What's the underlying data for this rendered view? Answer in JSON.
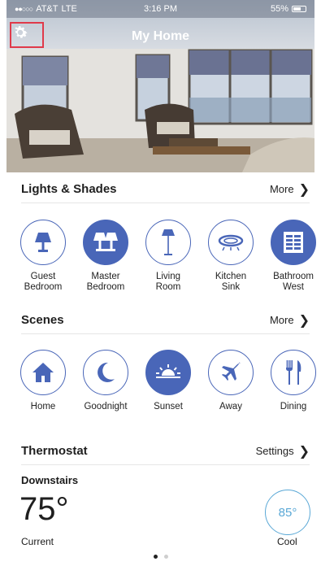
{
  "status_bar": {
    "carrier": "AT&T",
    "network": "LTE",
    "time": "3:16 PM",
    "battery": "55%"
  },
  "header": {
    "title": "My Home",
    "settings_icon": "gear-icon"
  },
  "lights": {
    "title": "Lights & Shades",
    "more_label": "More",
    "items": [
      {
        "label": "Guest\nBedroom",
        "icon": "table-lamp-icon",
        "active": false
      },
      {
        "label": "Master\nBedroom",
        "icon": "double-lamp-icon",
        "active": true
      },
      {
        "label": "Living\nRoom",
        "icon": "floor-lamp-icon",
        "active": false
      },
      {
        "label": "Kitchen\nSink",
        "icon": "ceiling-light-icon",
        "active": false
      },
      {
        "label": "Bathroom\nWest",
        "icon": "window-shade-icon",
        "active": true
      }
    ]
  },
  "scenes": {
    "title": "Scenes",
    "more_label": "More",
    "items": [
      {
        "label": "Home",
        "icon": "house-icon",
        "active": false
      },
      {
        "label": "Goodnight",
        "icon": "moon-icon",
        "active": false
      },
      {
        "label": "Sunset",
        "icon": "sunset-icon",
        "active": true
      },
      {
        "label": "Away",
        "icon": "airplane-icon",
        "active": false
      },
      {
        "label": "Dining",
        "icon": "fork-knife-icon",
        "active": false
      }
    ]
  },
  "thermostat": {
    "title": "Thermostat",
    "settings_label": "Settings",
    "zone": "Downstairs",
    "current_temp": "75°",
    "current_label": "Current",
    "setpoint": "85°",
    "mode": "Cool"
  },
  "colors": {
    "accent": "#4966b8",
    "cool": "#5aa8d6",
    "settings_highlight": "#e03a4a"
  },
  "pager": {
    "pages": 2,
    "active": 0
  }
}
